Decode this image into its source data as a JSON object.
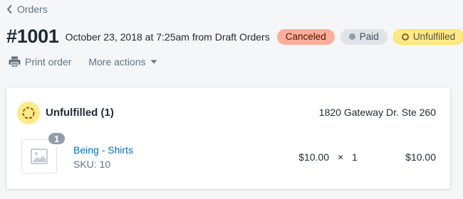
{
  "breadcrumb": {
    "label": "Orders"
  },
  "order": {
    "number": "#1001",
    "meta": "October 23, 2018 at 7:25am from Draft Orders"
  },
  "badges": {
    "canceled": "Canceled",
    "paid": "Paid",
    "unfulfilled": "Unfulfilled"
  },
  "actions": {
    "print": "Print order",
    "more": "More actions"
  },
  "fulfillment": {
    "title": "Unfulfilled (1)",
    "location": "1820 Gateway Dr. Ste 260",
    "line_item": {
      "quantity_badge": "1",
      "name": "Being - Shirts",
      "sku": "SKU: 10",
      "unit_price": "$10.00",
      "times": "×",
      "quantity": "1",
      "total": "$10.00"
    }
  },
  "colors": {
    "canceled_bg": "#fead9a",
    "paid_bg": "#dfe3e8",
    "unfulfilled_bg": "#ffea8a",
    "link": "#006fbb"
  }
}
